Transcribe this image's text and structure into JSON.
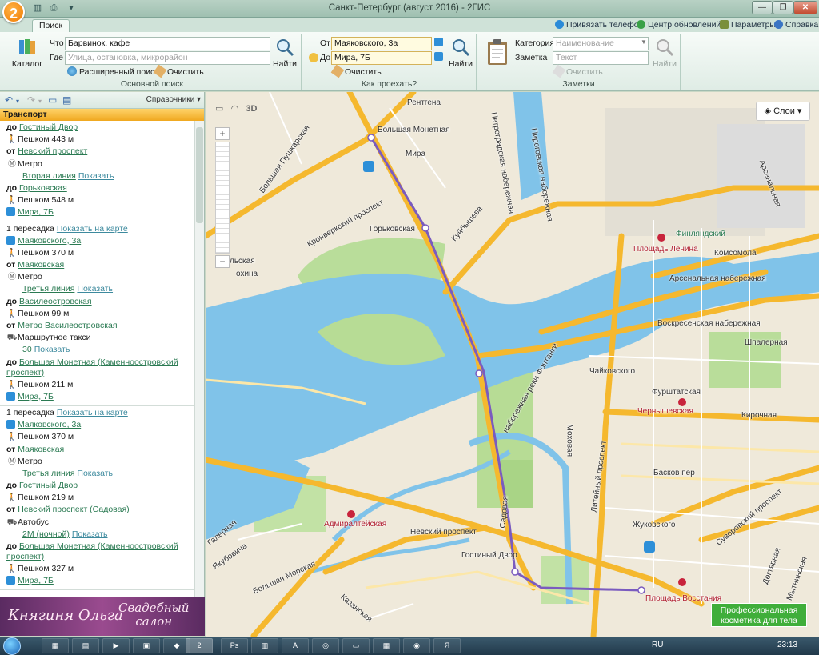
{
  "window": {
    "title": "Санкт-Петербург (август 2016) - 2ГИС",
    "logo": "2"
  },
  "tabs": {
    "search": "Поиск"
  },
  "top_links": {
    "phone": "Привязать телефон",
    "updates": "Центр обновлений",
    "params": "Параметры",
    "help": "Справка"
  },
  "basic_search": {
    "catalog_label": "Каталог",
    "what_label": "Что",
    "what_value": "Барвинок, кафе",
    "where_label": "Где",
    "where_placeholder": "Улица, остановка, микрорайон",
    "find_label": "Найти",
    "advanced_label": "Расширенный поиск",
    "clear_label": "Очистить",
    "group_title": "Основной поиск"
  },
  "route_search": {
    "from_label": "От",
    "from_value": "Маяковского, 3а",
    "to_label": "До",
    "to_value": "Мира, 7Б",
    "find_label": "Найти",
    "clear_label": "Очистить",
    "group_title": "Как проехать?"
  },
  "notes": {
    "category_label": "Категория",
    "category_placeholder": "Наименование",
    "note_label": "Заметка",
    "note_placeholder": "Текст",
    "find_label": "Найти",
    "clear_label": "Очистить",
    "group_title": "Заметки"
  },
  "left_panel": {
    "handbook": "Справочники",
    "header": "Транспорт",
    "route1": {
      "r1": {
        "k": "до",
        "v": "Гостиный Двор"
      },
      "r2": {
        "k": "Пешком 443 м"
      },
      "r3": {
        "k": "от",
        "v": "Невский проспект"
      },
      "r4": {
        "k": "Метро"
      },
      "r5": {
        "v": "Вторая линия",
        "link": "Показать"
      },
      "r6": {
        "k": "до",
        "v": "Горьковская"
      },
      "r7": {
        "k": "Пешком 548 м"
      },
      "r8": {
        "v": "Мира, 7Б"
      }
    },
    "route2": {
      "head": "1 пересадка",
      "head_link": "Показать на карте",
      "r1": {
        "v": "Маяковского, 3а"
      },
      "r2": {
        "k": "Пешком 370 м"
      },
      "r3": {
        "k": "от",
        "v": "Маяковская"
      },
      "r4": {
        "k": "Метро"
      },
      "r5": {
        "v": "Третья линия",
        "link": "Показать"
      },
      "r6": {
        "k": "до",
        "v": "Василеостровская"
      },
      "r7": {
        "k": "Пешком 99 м"
      },
      "r8": {
        "k": "от",
        "v": "Метро Василеостровская"
      },
      "r9": {
        "k": "Маршрутное такси"
      },
      "r10": {
        "v": "30",
        "link": "Показать"
      },
      "r11": {
        "k": "до",
        "v": "Большая Монетная (Каменноостровский проспект)"
      },
      "r12": {
        "k": "Пешком 211 м"
      },
      "r13": {
        "v": "Мира, 7Б"
      }
    },
    "route3": {
      "head": "1 пересадка",
      "head_link": "Показать на карте",
      "r1": {
        "v": "Маяковского, 3а"
      },
      "r2": {
        "k": "Пешком 370 м"
      },
      "r3": {
        "k": "от",
        "v": "Маяковская"
      },
      "r4": {
        "k": "Метро"
      },
      "r5": {
        "v": "Третья линия",
        "link": "Показать"
      },
      "r6": {
        "k": "до",
        "v": "Гостиный Двор"
      },
      "r7": {
        "k": "Пешком 219 м"
      },
      "r8": {
        "k": "от",
        "v": "Невский проспект (Садовая)"
      },
      "r9": {
        "k": "Автобус"
      },
      "r10": {
        "v": "2М (ночной)",
        "link": "Показать"
      },
      "r11": {
        "k": "до",
        "v": "Большая Монетная (Каменноостровский проспект)"
      },
      "r12": {
        "k": "Пешком 327 м"
      },
      "r13": {
        "v": "Мира, 7Б"
      }
    }
  },
  "banner": {
    "brand": "Княгиня Ольга",
    "line1": "Свадебный",
    "line2": "салон"
  },
  "map": {
    "layers": "Слои",
    "view_3d": "3D",
    "promo_line1": "Профессиональная",
    "promo_line2": "косметика для тела",
    "labels": {
      "rentgena": "Рентгена",
      "bolshaya_monetnaya": "Большая Монетная",
      "mira": "Мира",
      "bolshoy_pushkarskaya": "Большая Пушкарская",
      "kronverksky": "Кронверкский проспект",
      "gorkovskaya": "Горьковская",
      "kuybysheva": "Куйбышева",
      "petrogradskaya": "Петроградская набережная",
      "pirogovskaya": "Пироговская набережная",
      "finlyandsky": "Финляндский",
      "ploshchad_lenina": "Площадь Ленина",
      "komsomola": "Комсомола",
      "arsenalnaya_nab": "Арсенальная набережная",
      "voskresenskaya": "Воскресенская набережная",
      "shpalernaya": "Шпалерная",
      "chaykovskogo": "Чайковского",
      "furshtatskaya": "Фурштатская",
      "kirochnaya": "Кирочная",
      "chernyshevskaya": "Чернышевская",
      "mokhovaya": "Моховая",
      "liteyny": "Литейный проспект",
      "basov": "Басков пер",
      "zhukovskogo": "Жуковского",
      "suvorovsky": "Суворовский проспект",
      "admiralteyskaya": "Адмиралтейская",
      "nevsky": "Невский проспект",
      "gostiny": "Гостиный Двор",
      "sadovaya": "Садовая",
      "ploshchad_vosstaniya": "Площадь Восстания",
      "bolshaya_morskaya": "Большая Морская",
      "kazanskaya": "Казанская",
      "yakubovicha": "Якубовича",
      "galernaya": "Галерная",
      "fontanka1": "набережная реки Фонтанки",
      "arsenalnaya": "Арсенальная",
      "degtyarnaya": "Дегтярная",
      "mytninskaya": "Мытнинская",
      "lskaya": "льская",
      "pokhina": "охина"
    }
  },
  "taskbar": {
    "lang": "RU",
    "clock": "23:13"
  }
}
